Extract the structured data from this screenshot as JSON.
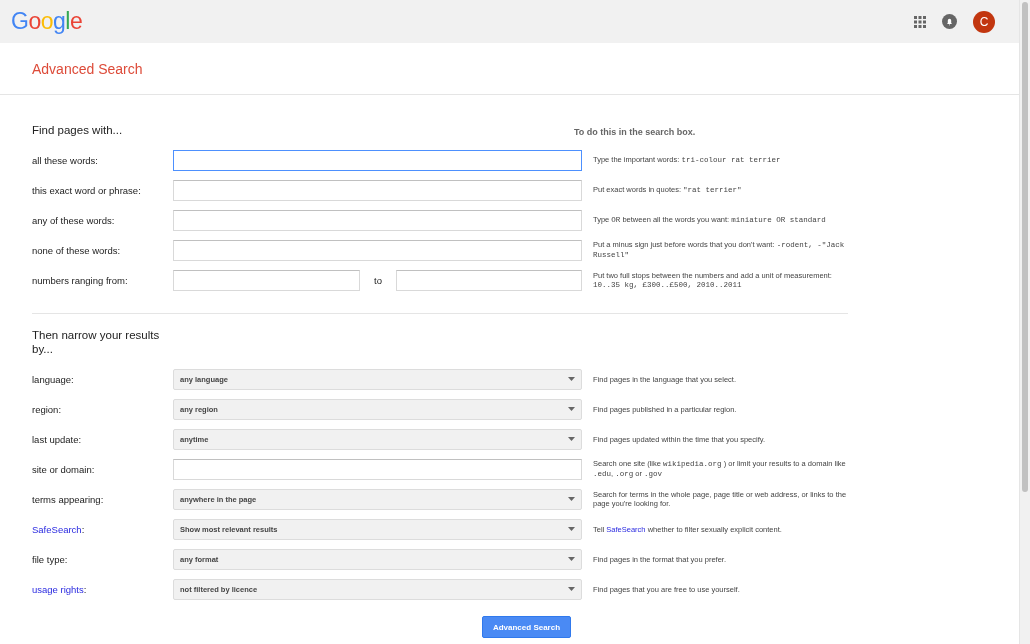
{
  "header": {
    "logo": "Google",
    "avatar": "C"
  },
  "page_title": "Advanced Search",
  "find_section": {
    "heading": "Find pages with...",
    "hint_heading": "To do this in the search box.",
    "rows": [
      {
        "kind": "text",
        "label": [
          {
            "kind": "text",
            "text": "all these words:"
          }
        ],
        "focused": true,
        "hint": [
          {
            "kind": "text",
            "text": "Type the important words: "
          },
          {
            "kind": "code",
            "text": "tri-colour rat terrier"
          }
        ]
      },
      {
        "kind": "text",
        "label": [
          {
            "kind": "text",
            "text": "this exact word or phrase:"
          }
        ],
        "focused": false,
        "hint": [
          {
            "kind": "text",
            "text": "Put exact words in quotes: "
          },
          {
            "kind": "code",
            "text": "\"rat terrier\""
          }
        ]
      },
      {
        "kind": "text",
        "label": [
          {
            "kind": "text",
            "text": "any of these words:"
          }
        ],
        "focused": false,
        "hint": [
          {
            "kind": "text",
            "text": "Type "
          },
          {
            "kind": "code",
            "text": "OR"
          },
          {
            "kind": "text",
            "text": " between all the words you want: "
          },
          {
            "kind": "code",
            "text": "miniature OR standard"
          }
        ]
      },
      {
        "kind": "text",
        "label": [
          {
            "kind": "text",
            "text": "none of these words:"
          }
        ],
        "focused": false,
        "hint": [
          {
            "kind": "text",
            "text": "Put a minus sign just before words that you don't want: "
          },
          {
            "kind": "code",
            "text": "-rodent, -\"Jack Russell\""
          }
        ]
      },
      {
        "kind": "range",
        "label": [
          {
            "kind": "text",
            "text": "numbers ranging from:"
          }
        ],
        "separator": "to",
        "hint": [
          {
            "kind": "text",
            "text": "Put two full stops between the numbers and add a unit of measurement: "
          },
          {
            "kind": "code",
            "text": "10..35 kg, £300..£500, 2010..2011"
          }
        ]
      }
    ]
  },
  "narrow_section": {
    "heading": "Then narrow your results by...",
    "rows": [
      {
        "kind": "select",
        "label": [
          {
            "kind": "text",
            "text": "language:"
          }
        ],
        "value": "any language",
        "hint": [
          {
            "kind": "text",
            "text": "Find pages in the language that you select."
          }
        ]
      },
      {
        "kind": "select",
        "label": [
          {
            "kind": "text",
            "text": "region:"
          }
        ],
        "value": "any region",
        "hint": [
          {
            "kind": "text",
            "text": "Find pages published in a particular region."
          }
        ]
      },
      {
        "kind": "select",
        "label": [
          {
            "kind": "text",
            "text": "last update:"
          }
        ],
        "value": "anytime",
        "hint": [
          {
            "kind": "text",
            "text": "Find pages updated within the time that you specify."
          }
        ]
      },
      {
        "kind": "text",
        "label": [
          {
            "kind": "text",
            "text": "site or domain:"
          }
        ],
        "focused": false,
        "hint": [
          {
            "kind": "text",
            "text": "Search one site (like "
          },
          {
            "kind": "code",
            "text": "wikipedia.org"
          },
          {
            "kind": "text",
            "text": " ) or limit your results to a domain like "
          },
          {
            "kind": "code",
            "text": ".edu"
          },
          {
            "kind": "text",
            "text": ", "
          },
          {
            "kind": "code",
            "text": ".org"
          },
          {
            "kind": "text",
            "text": " or "
          },
          {
            "kind": "code",
            "text": ".gov"
          }
        ]
      },
      {
        "kind": "select",
        "label": [
          {
            "kind": "text",
            "text": "terms appearing:"
          }
        ],
        "value": "anywhere in the page",
        "hint": [
          {
            "kind": "text",
            "text": "Search for terms in the whole page, page title or web address, or links to the page you're looking for."
          }
        ]
      },
      {
        "kind": "select",
        "label": [
          {
            "kind": "link",
            "text": "SafeSearch"
          },
          {
            "kind": "text",
            "text": ":"
          }
        ],
        "value": "Show most relevant results",
        "hint": [
          {
            "kind": "text",
            "text": "Tell "
          },
          {
            "kind": "link",
            "text": "SafeSearch"
          },
          {
            "kind": "text",
            "text": " whether to filter sexually explicit content."
          }
        ]
      },
      {
        "kind": "select",
        "label": [
          {
            "kind": "text",
            "text": "file type:"
          }
        ],
        "value": "any format",
        "hint": [
          {
            "kind": "text",
            "text": "Find pages in the format that you prefer."
          }
        ]
      },
      {
        "kind": "select",
        "label": [
          {
            "kind": "link",
            "text": "usage rights"
          },
          {
            "kind": "text",
            "text": ":"
          }
        ],
        "value": "not filtered by licence",
        "hint": [
          {
            "kind": "text",
            "text": "Find pages that you are free to use yourself."
          }
        ]
      }
    ]
  },
  "submit_button": "Advanced Search"
}
